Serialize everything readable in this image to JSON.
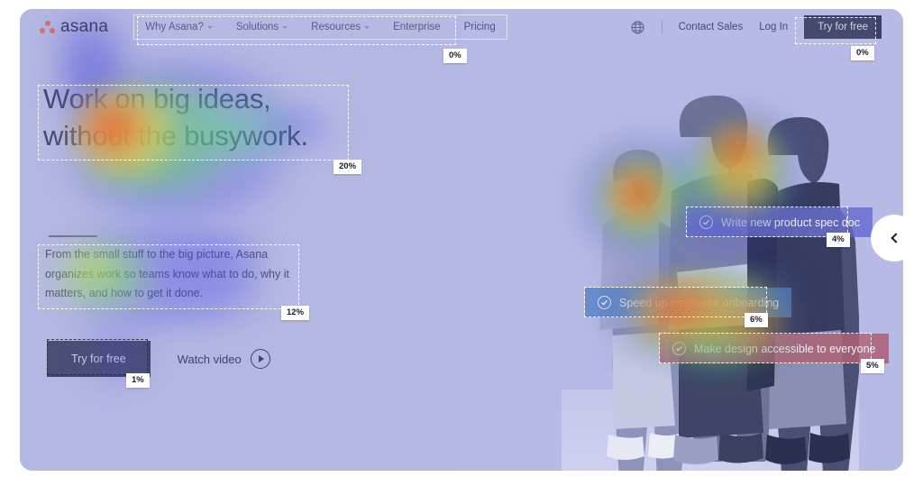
{
  "header": {
    "brand": "asana",
    "brand_icon": "asana-logo-dots",
    "nav_items": [
      {
        "label": "Why Asana?",
        "has_caret": true
      },
      {
        "label": "Solutions",
        "has_caret": true
      },
      {
        "label": "Resources",
        "has_caret": true
      },
      {
        "label": "Enterprise",
        "has_caret": false
      },
      {
        "label": "Pricing",
        "has_caret": false
      }
    ],
    "language_icon": "globe-icon",
    "contact_sales": "Contact Sales",
    "log_in": "Log In",
    "try_for_free": "Try for free"
  },
  "hero": {
    "headline_line1": "Work on big ideas,",
    "headline_line2": "without the busywork.",
    "subheadline": "From the small stuff to the big picture, Asana organizes work so teams know what to do, why it matters, and how to get it done.",
    "primary_cta": "Try for free",
    "secondary_cta": "Watch video",
    "secondary_cta_icon": "play-circle-icon"
  },
  "task_cards": [
    {
      "id": "spec",
      "label": "Write new product spec doc",
      "icon": "check-circle-icon",
      "color": "#6268d0"
    },
    {
      "id": "onboard",
      "label": "Speed up employee onboarding",
      "icon": "check-circle-icon",
      "color": "#4e7cc4"
    },
    {
      "id": "design",
      "label": "Make design accessible to everyone",
      "icon": "check-circle-icon",
      "color": "#ac586a"
    }
  ],
  "carousel": {
    "prev_icon": "chevron-left-icon"
  },
  "heatmap_labels": {
    "nav_group": "0%",
    "try_for_free_header": "0%",
    "headline": "20%",
    "subheadline": "12%",
    "try_for_free_hero": "1%",
    "card_spec": "4%",
    "card_onboard": "6%",
    "card_design": "5%"
  },
  "theme": {
    "page_background": "#b4b8e3",
    "text_dark": "#3d4165",
    "button_dark": "#42466d",
    "accent_red": "#d96a72",
    "label_background": "#fdfdfd"
  }
}
